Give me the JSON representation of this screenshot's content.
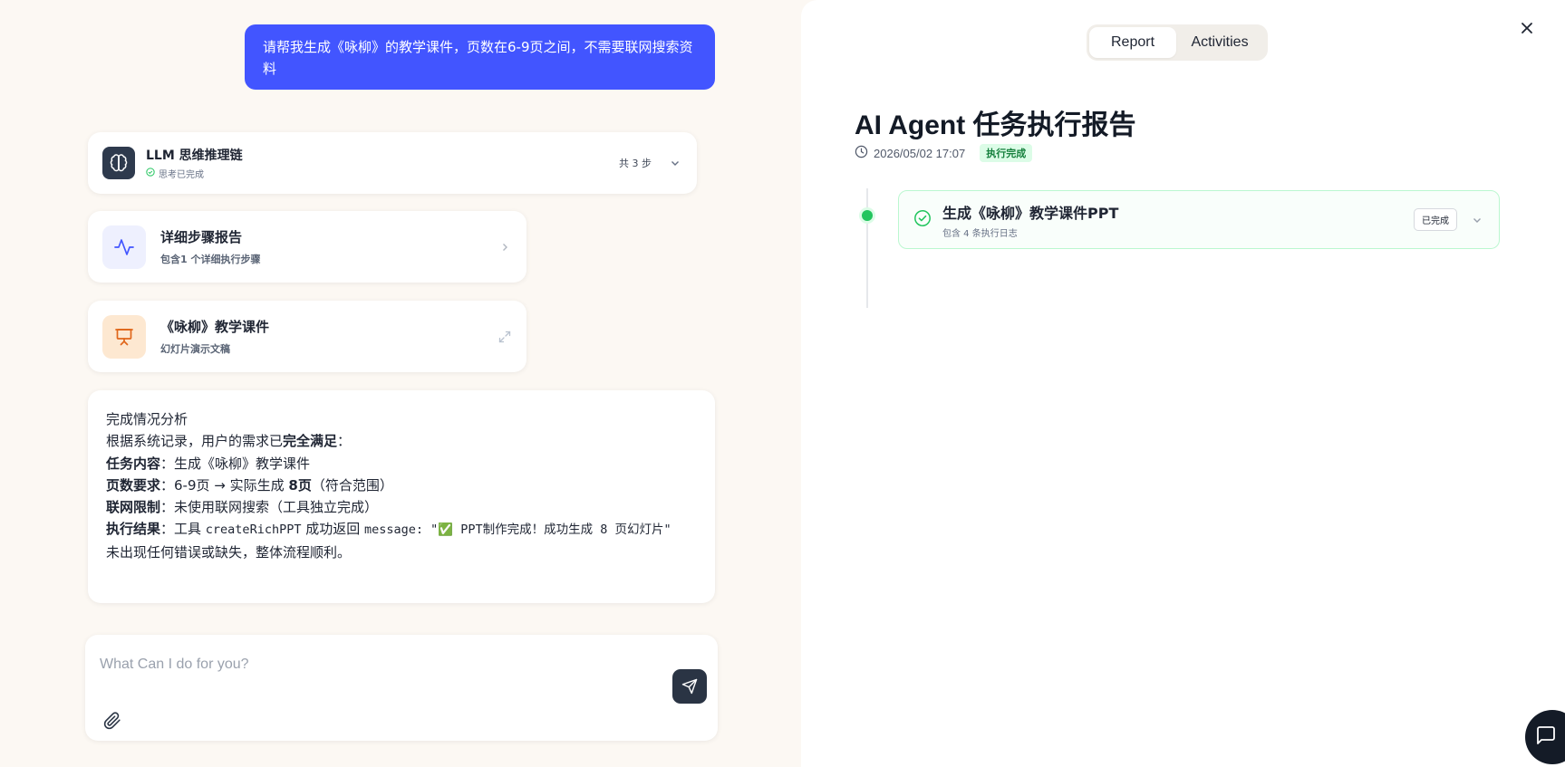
{
  "user_message": "请帮我生成《咏柳》的教学课件，页数在6-9页之间，不需要联网搜索资料",
  "llm_card": {
    "title": "LLM 思维推理链",
    "status": "思考已完成",
    "steps": "共 3 步",
    "icon": "brain-icon"
  },
  "step_report_card": {
    "title": "详细步骤报告",
    "subtitle": "包含1 个详细执行步骤",
    "icon": "activity-icon"
  },
  "ppt_card": {
    "title": "《咏柳》教学课件",
    "subtitle": "幻灯片演示文稿",
    "icon": "presentation-icon"
  },
  "analysis": {
    "heading": "完成情况分析",
    "intro_prefix": "根据系统记录，用户的需求已",
    "intro_bold": "完全满足",
    "intro_suffix": "：",
    "task_label": "任务内容",
    "task_value": "：生成《咏柳》教学课件",
    "pages_label": "页数要求",
    "pages_value_prefix": "：6-9页 → 实际生成 ",
    "pages_value_bold": "8页",
    "pages_value_suffix": "（符合范围）",
    "network_label": "联网限制",
    "network_value": "：未使用联网搜索（工具独立完成）",
    "result_label": "执行结果",
    "result_prefix": "：工具 ",
    "result_tool": "createRichPPT",
    "result_mid": " 成功返回 ",
    "result_message": "message: \"✅ PPT制作完成！成功生成 8 页幻灯片\"",
    "closing": "未出现任何错误或缺失，整体流程顺利。"
  },
  "composer": {
    "placeholder": "What Can I do for you?"
  },
  "panel": {
    "tabs": [
      "Report",
      "Activities"
    ],
    "active_tab": "Report",
    "title": "AI Agent 任务执行报告",
    "timestamp": "2026/05/02 17:07",
    "status_badge": "执行完成",
    "task": {
      "title": "生成《咏柳》教学课件PPT",
      "subtitle": "包含 4 条执行日志",
      "status": "已完成"
    }
  },
  "colors": {
    "accent_blue": "#4255ff",
    "success_green": "#22c55e",
    "dark": "#2a3444",
    "background": "#fcf8f3"
  }
}
